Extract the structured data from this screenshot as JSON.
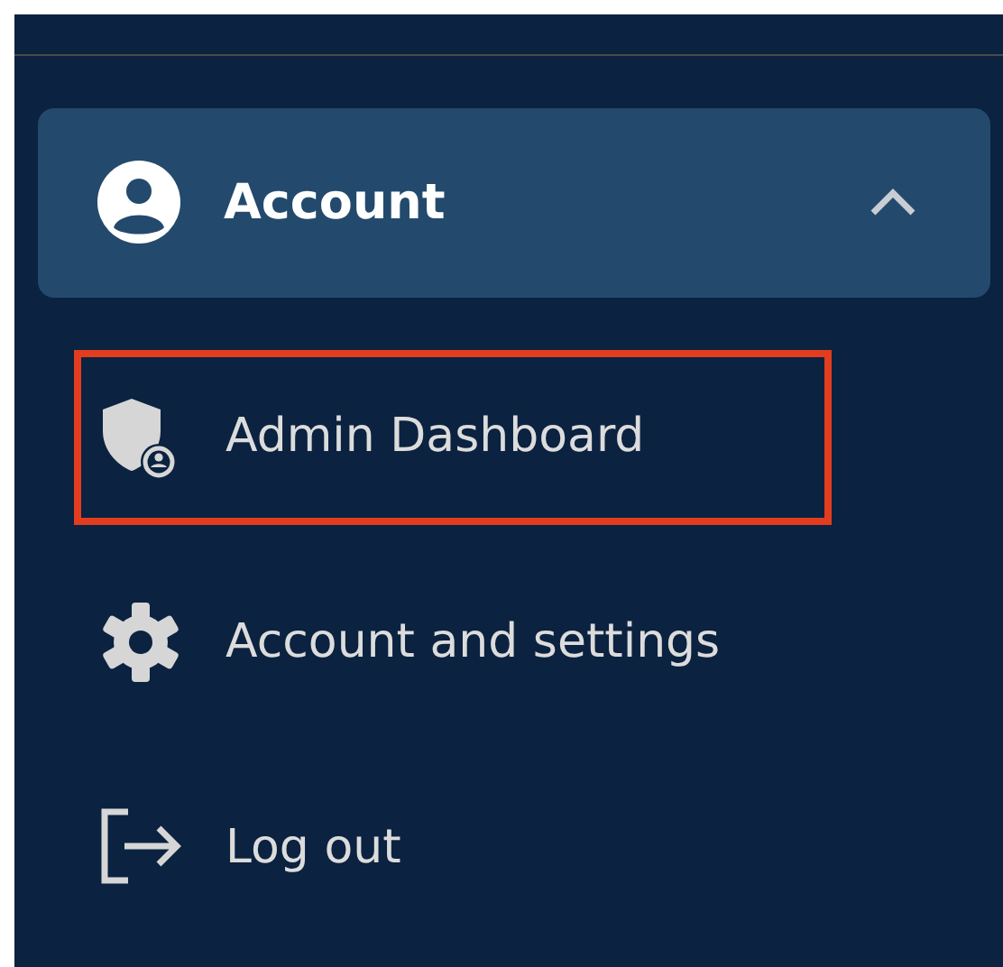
{
  "menu": {
    "header": {
      "label": "Account",
      "expanded": true
    },
    "items": [
      {
        "label": "Admin Dashboard",
        "kind": "admin",
        "highlighted": true
      },
      {
        "label": "Account and settings",
        "kind": "settings",
        "highlighted": false
      },
      {
        "label": "Log out",
        "kind": "logout",
        "highlighted": false
      }
    ]
  }
}
